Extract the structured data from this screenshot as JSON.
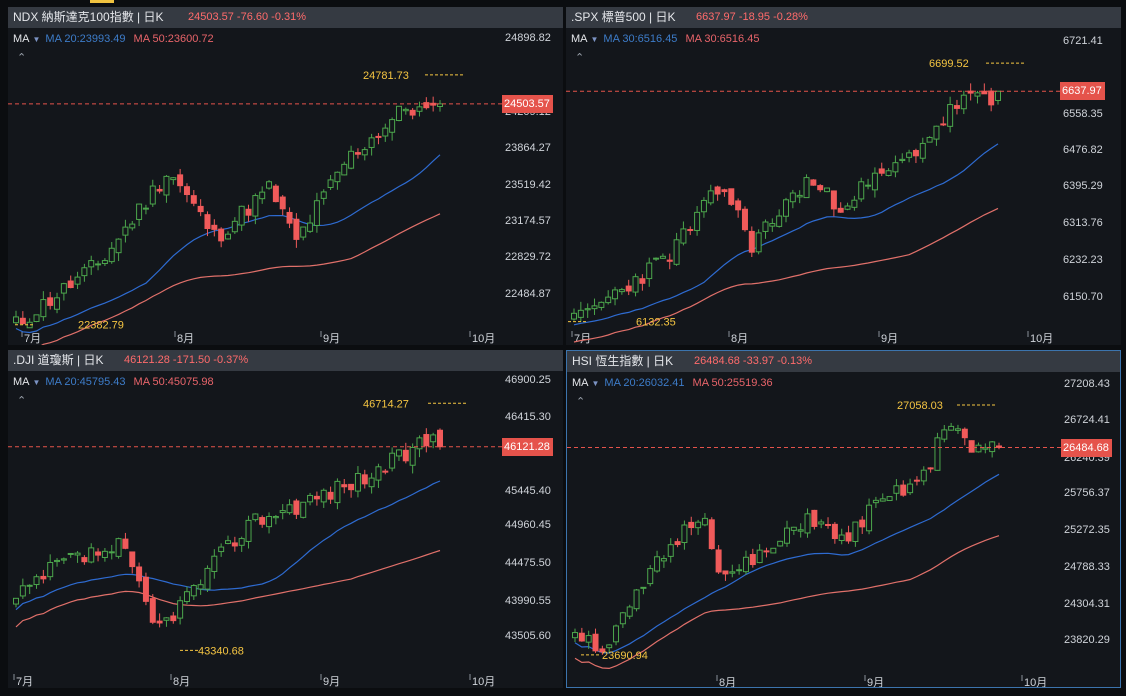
{
  "app": {
    "accent_color": "#f0c240"
  },
  "colors": {
    "up": "#4ca64c",
    "down": "#f05a5a",
    "ma20": "#2e6bd1",
    "ma50": "#e0706a",
    "extreme_label": "#f5c542",
    "axis_text": "#cfd3d9",
    "last_price_bg": "#e5534b"
  },
  "panes": [
    {
      "id": "ndx",
      "active": false,
      "header": {
        "symbol_label": "NDX 納斯達克100指數 | 日K",
        "quote": "24503.57 -76.60 -0.31%"
      },
      "ma": {
        "title": "MA",
        "ma20": "MA 20:23993.49",
        "ma50": "MA 50:23600.72"
      },
      "collapse_icon": "chevron-up-icon",
      "price_axis": [
        "24898.82",
        "24503.57",
        "24209.12",
        "23864.27",
        "23519.42",
        "23174.57",
        "22829.72",
        "22484.87"
      ],
      "last_price": "24503.57",
      "months": [
        "7月",
        "8月",
        "9月",
        "10月"
      ],
      "high_label": "24781.73",
      "low_label": "22382.79",
      "chart_data": {
        "type": "candlestick",
        "xlabel": "",
        "ylabel": "",
        "x_ticks": [
          "7月",
          "8月",
          "9月",
          "10月"
        ],
        "y_range": [
          22380,
          25050
        ],
        "series": {
          "ma20_last": 23993.49,
          "ma50_last": 23600.72
        },
        "last_price": 24503.57,
        "high": 24781.73,
        "low": 22382.79,
        "start_price": 22420,
        "end_price": 24503.57,
        "noise_amplitude": 185,
        "day_count": 63,
        "seed": 11,
        "path_shape": [
          [
            0,
            0
          ],
          [
            0.2,
            0.25
          ],
          [
            0.36,
            0.62
          ],
          [
            0.47,
            0.35
          ],
          [
            0.6,
            0.55
          ],
          [
            0.66,
            0.33
          ],
          [
            0.78,
            0.66
          ],
          [
            0.92,
            0.87
          ],
          [
            1,
            0.84
          ]
        ]
      }
    },
    {
      "id": "spx",
      "active": false,
      "header": {
        "symbol_label": ".SPX 標普500 | 日K",
        "quote": "6637.97 -18.95 -0.28%"
      },
      "ma": {
        "title": "MA",
        "ma20": "MA 30:6516.45",
        "ma50": "MA 30:6516.45"
      },
      "collapse_icon": "chevron-up-icon",
      "price_axis": [
        "6721.41",
        "6637.97",
        "6558.35",
        "6476.82",
        "6395.29",
        "6313.76",
        "6232.23",
        "6150.70"
      ],
      "last_price": "6637.97",
      "months": [
        "7月",
        "8月",
        "9月",
        "10月"
      ],
      "high_label": "6699.52",
      "low_label": "6132.35",
      "chart_data": {
        "type": "candlestick",
        "xlabel": "",
        "ylabel": "",
        "x_ticks": [
          "7月",
          "8月",
          "9月",
          "10月"
        ],
        "y_range": [
          6125,
          6735
        ],
        "series": {
          "ma30_last": 6516.45
        },
        "last_price": 6637.97,
        "high": 6699.52,
        "low": 6132.35,
        "start_price": 6140,
        "end_price": 6637.97,
        "noise_amplitude": 42,
        "day_count": 63,
        "seed": 23,
        "path_shape": [
          [
            0,
            0
          ],
          [
            0.22,
            0.25
          ],
          [
            0.35,
            0.53
          ],
          [
            0.42,
            0.3
          ],
          [
            0.55,
            0.55
          ],
          [
            0.62,
            0.45
          ],
          [
            0.78,
            0.62
          ],
          [
            0.92,
            0.87
          ],
          [
            1,
            0.84
          ]
        ]
      }
    },
    {
      "id": "dji",
      "active": false,
      "header": {
        "symbol_label": ".DJI 道瓊斯 | 日K",
        "quote": "46121.28 -171.50 -0.37%"
      },
      "ma": {
        "title": "MA",
        "ma20": "MA 20:45795.43",
        "ma50": "MA 50:45075.98"
      },
      "collapse_icon": "chevron-up-icon",
      "price_axis": [
        "46900.25",
        "46415.30",
        "46121.28",
        "45930.35",
        "45445.40",
        "44960.45",
        "44475.50",
        "43990.55",
        "43505.60"
      ],
      "last_price": "46121.28",
      "months": [
        "7月",
        "8月",
        "9月",
        "10月"
      ],
      "high_label": "46714.27",
      "low_label": "43340.68",
      "chart_data": {
        "type": "candlestick",
        "xlabel": "",
        "ylabel": "",
        "x_ticks": [
          "7月",
          "8月",
          "9月",
          "10月"
        ],
        "y_range": [
          43100,
          46950
        ],
        "series": {
          "ma20_last": 45795.43,
          "ma50_last": 45075.98
        },
        "last_price": 46121.28,
        "high": 46714.27,
        "low": 43340.68,
        "start_price": 44100,
        "end_price": 46121.28,
        "noise_amplitude": 260,
        "day_count": 63,
        "seed": 37,
        "path_shape": [
          [
            0,
            0.2
          ],
          [
            0.1,
            0.35
          ],
          [
            0.25,
            0.42
          ],
          [
            0.33,
            0.08
          ],
          [
            0.42,
            0.25
          ],
          [
            0.55,
            0.52
          ],
          [
            0.68,
            0.6
          ],
          [
            0.85,
            0.72
          ],
          [
            1,
            0.88
          ]
        ]
      }
    },
    {
      "id": "hsi",
      "active": true,
      "header": {
        "symbol_label": "HSI 恆生指數 | 日K",
        "quote": "26484.68 -33.97 -0.13%"
      },
      "ma": {
        "title": "MA",
        "ma20": "MA 20:26032.41",
        "ma50": "MA 50:25519.36"
      },
      "collapse_icon": "chevron-up-icon",
      "price_axis": [
        "27208.43",
        "26724.41",
        "26484.68",
        "26240.39",
        "25756.37",
        "25272.35",
        "24788.33",
        "24304.31",
        "23820.29"
      ],
      "last_price": "26484.68",
      "months": [
        "8月",
        "9月",
        "10月"
      ],
      "high_label": "27058.03",
      "low_label": "23690.94",
      "chart_data": {
        "type": "candlestick",
        "xlabel": "",
        "ylabel": "",
        "x_ticks": [
          "8月",
          "9月",
          "10月"
        ],
        "y_range": [
          23500,
          27300
        ],
        "series": {
          "ma20_last": 26032.41,
          "ma50_last": 25519.36
        },
        "last_price": 26484.68,
        "high": 27058.03,
        "low": 23690.94,
        "start_price": 24100,
        "end_price": 26484.68,
        "noise_amplitude": 230,
        "day_count": 63,
        "seed": 51,
        "path_shape": [
          [
            0,
            0.1
          ],
          [
            0.07,
            0.02
          ],
          [
            0.2,
            0.38
          ],
          [
            0.3,
            0.58
          ],
          [
            0.35,
            0.3
          ],
          [
            0.48,
            0.44
          ],
          [
            0.55,
            0.56
          ],
          [
            0.63,
            0.45
          ],
          [
            0.7,
            0.58
          ],
          [
            0.83,
            0.72
          ],
          [
            0.88,
            0.96
          ],
          [
            0.94,
            0.8
          ],
          [
            1,
            0.84
          ]
        ]
      }
    }
  ]
}
